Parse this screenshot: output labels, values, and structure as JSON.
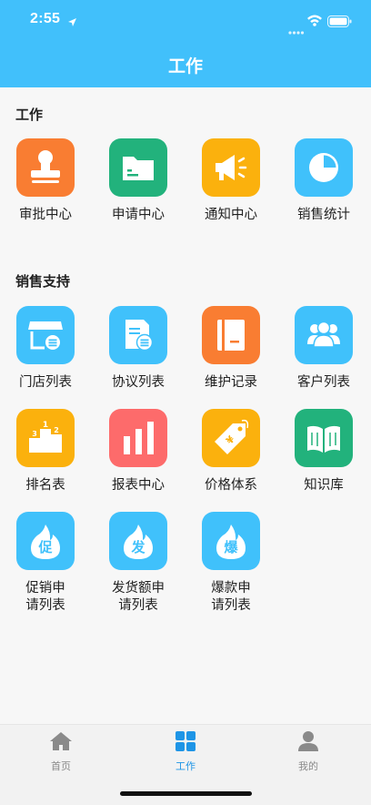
{
  "status_bar": {
    "time": "2:55"
  },
  "header": {
    "title": "工作"
  },
  "sections": [
    {
      "title": "工作",
      "items": [
        {
          "label": "审批中心",
          "icon": "stamp-icon",
          "color": "#f97d32"
        },
        {
          "label": "申请中心",
          "icon": "folder-icon",
          "color": "#22b27c"
        },
        {
          "label": "通知中心",
          "icon": "megaphone-icon",
          "color": "#fbb10d"
        },
        {
          "label": "销售统计",
          "icon": "pie-chart-icon",
          "color": "#40c1fb"
        }
      ]
    },
    {
      "title": "销售支持",
      "items": [
        {
          "label": "门店列表",
          "icon": "store-icon",
          "color": "#40c1fb"
        },
        {
          "label": "协议列表",
          "icon": "document-list-icon",
          "color": "#40c1fb"
        },
        {
          "label": "维护记录",
          "icon": "notebook-icon",
          "color": "#f97d32"
        },
        {
          "label": "客户列表",
          "icon": "customers-icon",
          "color": "#40c1fb"
        },
        {
          "label": "排名表",
          "icon": "podium-icon",
          "color": "#fbb10d"
        },
        {
          "label": "报表中心",
          "icon": "bar-chart-icon",
          "color": "#fd6b6b"
        },
        {
          "label": "价格体系",
          "icon": "price-tag-icon",
          "color": "#fbb10d"
        },
        {
          "label": "知识库",
          "icon": "book-icon",
          "color": "#22b27c"
        },
        {
          "label": "促销申\n请列表",
          "icon": "promo-flame-icon",
          "glyph": "促",
          "color": "#40c1fb"
        },
        {
          "label": "发货额申\n请列表",
          "icon": "shipment-flame-icon",
          "glyph": "发",
          "color": "#40c1fb"
        },
        {
          "label": "爆款申\n请列表",
          "icon": "hot-item-flame-icon",
          "glyph": "爆",
          "color": "#40c1fb"
        }
      ]
    }
  ],
  "tabbar": {
    "tabs": [
      {
        "label": "首页",
        "icon": "home-icon",
        "active": false
      },
      {
        "label": "工作",
        "icon": "grid-icon",
        "active": true
      },
      {
        "label": "我的",
        "icon": "person-icon",
        "active": false
      }
    ],
    "active_color": "#1e95e6",
    "inactive_color": "#8a8a8a"
  }
}
